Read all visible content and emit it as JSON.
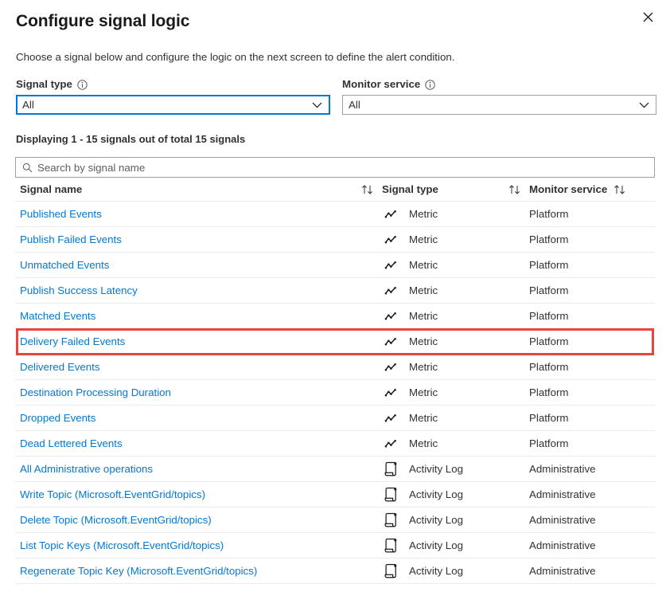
{
  "blade": {
    "title": "Configure signal logic",
    "close_label": "Close",
    "close_icon": "close-icon",
    "description": "Choose a signal below and configure the logic on the next screen to define the alert condition."
  },
  "filters": [
    {
      "label": "Signal type",
      "info_icon": "info-icon",
      "value": "All",
      "focused": true,
      "chevron_icon": "chevron-down-icon"
    },
    {
      "label": "Monitor service",
      "info_icon": "info-icon",
      "value": "All",
      "focused": false,
      "chevron_icon": "chevron-down-icon"
    }
  ],
  "results": {
    "count_text": "Displaying 1 - 15 signals out of total 15 signals"
  },
  "search": {
    "placeholder": "Search by signal name",
    "value": "",
    "icon": "search-icon"
  },
  "table": {
    "columns": [
      {
        "label": "Signal name",
        "sort_icon": "sort-ascending-descending-icon"
      },
      {
        "label": "Signal type",
        "sort_icon": "sort-ascending-descending-icon"
      },
      {
        "label": "Monitor service",
        "sort_icon": "sort-ascending-descending-icon"
      }
    ],
    "rows": [
      {
        "name": "Published Events",
        "type": "Metric",
        "type_icon": "metric-line-chart-icon",
        "service": "Platform",
        "highlighted": false
      },
      {
        "name": "Publish Failed Events",
        "type": "Metric",
        "type_icon": "metric-line-chart-icon",
        "service": "Platform",
        "highlighted": false
      },
      {
        "name": "Unmatched Events",
        "type": "Metric",
        "type_icon": "metric-line-chart-icon",
        "service": "Platform",
        "highlighted": false
      },
      {
        "name": "Publish Success Latency",
        "type": "Metric",
        "type_icon": "metric-line-chart-icon",
        "service": "Platform",
        "highlighted": false
      },
      {
        "name": "Matched Events",
        "type": "Metric",
        "type_icon": "metric-line-chart-icon",
        "service": "Platform",
        "highlighted": false
      },
      {
        "name": "Delivery Failed Events",
        "type": "Metric",
        "type_icon": "metric-line-chart-icon",
        "service": "Platform",
        "highlighted": true
      },
      {
        "name": "Delivered Events",
        "type": "Metric",
        "type_icon": "metric-line-chart-icon",
        "service": "Platform",
        "highlighted": false
      },
      {
        "name": "Destination Processing Duration",
        "type": "Metric",
        "type_icon": "metric-line-chart-icon",
        "service": "Platform",
        "highlighted": false
      },
      {
        "name": "Dropped Events",
        "type": "Metric",
        "type_icon": "metric-line-chart-icon",
        "service": "Platform",
        "highlighted": false
      },
      {
        "name": "Dead Lettered Events",
        "type": "Metric",
        "type_icon": "metric-line-chart-icon",
        "service": "Platform",
        "highlighted": false
      },
      {
        "name": "All Administrative operations",
        "type": "Activity Log",
        "type_icon": "activity-log-scroll-icon",
        "service": "Administrative",
        "highlighted": false
      },
      {
        "name": "Write Topic (Microsoft.EventGrid/topics)",
        "type": "Activity Log",
        "type_icon": "activity-log-scroll-icon",
        "service": "Administrative",
        "highlighted": false
      },
      {
        "name": "Delete Topic (Microsoft.EventGrid/topics)",
        "type": "Activity Log",
        "type_icon": "activity-log-scroll-icon",
        "service": "Administrative",
        "highlighted": false
      },
      {
        "name": "List Topic Keys (Microsoft.EventGrid/topics)",
        "type": "Activity Log",
        "type_icon": "activity-log-scroll-icon",
        "service": "Administrative",
        "highlighted": false
      },
      {
        "name": "Regenerate Topic Key (Microsoft.EventGrid/topics)",
        "type": "Activity Log",
        "type_icon": "activity-log-scroll-icon",
        "service": "Administrative",
        "highlighted": false
      }
    ]
  },
  "colors": {
    "link": "#0078d4",
    "accent": "#0078d4",
    "highlight": "#e8453c",
    "text": "#323130",
    "border": "#edebe9"
  }
}
